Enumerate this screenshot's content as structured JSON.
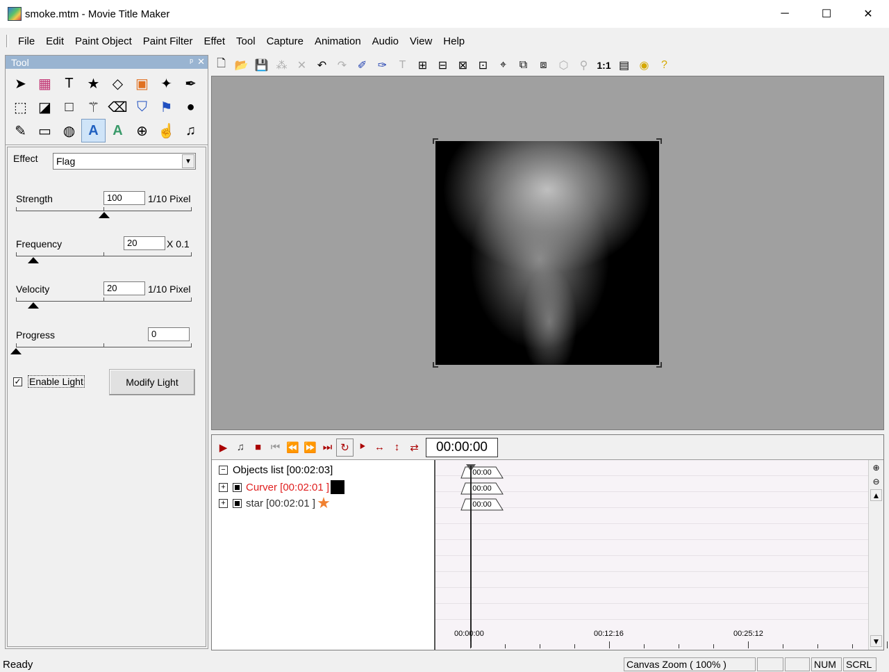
{
  "window": {
    "title": "smoke.mtm - Movie Title Maker",
    "minimize": "─",
    "maximize": "☐",
    "close": "✕"
  },
  "menu": [
    "File",
    "Edit",
    "Paint Object",
    "Paint Filter",
    "Effet",
    "Tool",
    "Capture",
    "Animation",
    "Audio",
    "View",
    "Help"
  ],
  "tool_panel": {
    "title": "Tool",
    "pin": "ᵖ",
    "close": "✕",
    "tools": [
      {
        "name": "select-arrow-icon",
        "glyph": "➤"
      },
      {
        "name": "color-bars-icon",
        "glyph": "▦"
      },
      {
        "name": "text-tool-icon",
        "glyph": "T"
      },
      {
        "name": "star-shape-icon",
        "glyph": "★"
      },
      {
        "name": "transform-icon",
        "glyph": "◇"
      },
      {
        "name": "image-object-icon",
        "glyph": "▣"
      },
      {
        "name": "sparkle-pen-icon",
        "glyph": "✦"
      },
      {
        "name": "pen-icon",
        "glyph": "✒"
      },
      {
        "name": "empty-slot",
        "glyph": ""
      },
      {
        "name": "marquee-select-icon",
        "glyph": "⬚"
      },
      {
        "name": "color-swap-icon",
        "glyph": "◪"
      },
      {
        "name": "rectangle-icon",
        "glyph": "□"
      },
      {
        "name": "magic-wand-icon",
        "glyph": "⚚"
      },
      {
        "name": "eraser-icon",
        "glyph": "⌫"
      },
      {
        "name": "paint-bucket-icon",
        "glyph": "⛉"
      },
      {
        "name": "spray-icon",
        "glyph": "⚑"
      },
      {
        "name": "drop-icon",
        "glyph": "●"
      },
      {
        "name": "empty-slot-2",
        "glyph": ""
      },
      {
        "name": "eyedropper-icon",
        "glyph": "✎"
      },
      {
        "name": "frame-icon",
        "glyph": "▭"
      },
      {
        "name": "blur-icon",
        "glyph": "◍"
      },
      {
        "name": "text-effect-icon",
        "glyph": "A"
      },
      {
        "name": "text-pattern-icon",
        "glyph": "A"
      },
      {
        "name": "zoom-icon",
        "glyph": "⊕"
      },
      {
        "name": "hand-icon",
        "glyph": "☝"
      },
      {
        "name": "music-note-icon",
        "glyph": "♫"
      },
      {
        "name": "empty-slot-3",
        "glyph": ""
      }
    ]
  },
  "props": {
    "effect_label": "Effect",
    "effect_value": "Flag",
    "strength_label": "Strength",
    "strength_value": "100",
    "strength_unit": "1/10 Pixel",
    "strength_level": 0.5,
    "frequency_label": "Frequency",
    "frequency_value": "20",
    "frequency_unit": "X 0.1",
    "frequency_level": 0.1,
    "velocity_label": "Velocity",
    "velocity_value": "20",
    "velocity_unit": "1/10 Pixel",
    "velocity_level": 0.1,
    "progress_label": "Progress",
    "progress_value": "0",
    "progress_level": 0,
    "enable_light_label": "Enable Light",
    "enable_light_checked": true,
    "modify_light_label": "Modify Light"
  },
  "toolbar": [
    {
      "name": "new-file-icon",
      "glyph": "🗋",
      "enabled": true
    },
    {
      "name": "open-folder-icon",
      "glyph": "📂",
      "enabled": true
    },
    {
      "name": "save-icon",
      "glyph": "💾",
      "enabled": true
    },
    {
      "name": "paint-icon",
      "glyph": "⁂",
      "enabled": false
    },
    {
      "name": "delete-icon",
      "glyph": "✕",
      "enabled": false
    },
    {
      "name": "undo-icon",
      "glyph": "↶",
      "enabled": true
    },
    {
      "name": "redo-icon",
      "glyph": "↷",
      "enabled": false
    },
    {
      "name": "brush-icon",
      "glyph": "✐",
      "enabled": true
    },
    {
      "name": "brush-alt-icon",
      "glyph": "✑",
      "enabled": true
    },
    {
      "name": "text-icon",
      "glyph": "T",
      "enabled": false
    },
    {
      "name": "align-left-icon",
      "glyph": "⊞",
      "enabled": true
    },
    {
      "name": "align-right-icon",
      "glyph": "⊟",
      "enabled": true
    },
    {
      "name": "align-top-icon",
      "glyph": "⊠",
      "enabled": true
    },
    {
      "name": "align-bottom-icon",
      "glyph": "⊡",
      "enabled": true
    },
    {
      "name": "center-icon",
      "glyph": "⌖",
      "enabled": true
    },
    {
      "name": "bring-front-icon",
      "glyph": "⧉",
      "enabled": true
    },
    {
      "name": "send-back-icon",
      "glyph": "⧈",
      "enabled": true
    },
    {
      "name": "group-icon",
      "glyph": "⬡",
      "enabled": false
    },
    {
      "name": "wand-icon",
      "glyph": "⚲",
      "enabled": false
    },
    {
      "name": "actual-size-icon",
      "glyph": "1:1",
      "enabled": true
    },
    {
      "name": "properties-icon",
      "glyph": "▤",
      "enabled": true
    },
    {
      "name": "circle-icon",
      "glyph": "◉",
      "enabled": true
    },
    {
      "name": "help-icon",
      "glyph": "?",
      "enabled": true
    }
  ],
  "timeline": {
    "time": "00:00:00",
    "objects_header": "Objects list [00:02:03]",
    "objects": [
      {
        "label": "Curver [00:02:01 ]",
        "color": "#e02020",
        "swatch": "#000000",
        "swatch_type": "box"
      },
      {
        "label": "star [00:02:01 ]",
        "color": "#333333",
        "swatch": "#f08030",
        "swatch_type": "star"
      }
    ],
    "keyframe_label": "00:00",
    "ruler": [
      "00:00:00",
      "00:12:16",
      "00:25:12"
    ],
    "zoom_in": "⊕",
    "zoom_out": "⊖"
  },
  "status": {
    "text": "Ready",
    "zoom": "Canvas Zoom ( 100% )",
    "num": "NUM",
    "scrl": "SCRL"
  }
}
